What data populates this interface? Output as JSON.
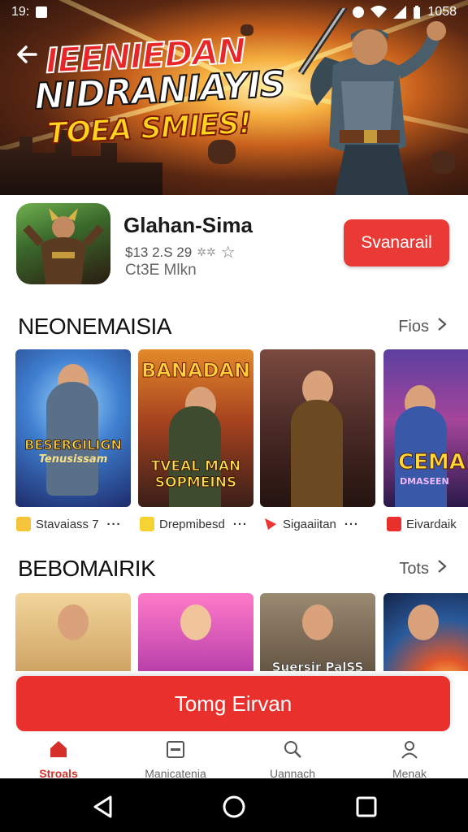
{
  "status_bar": {
    "time_left": "19:",
    "time_right": "1058"
  },
  "hero": {
    "title_line1": "IEENIEDAN",
    "title_line2": "NIDRANIAYIS",
    "title_line3": "TOEA SMIES!"
  },
  "app": {
    "name": "Glahan-Sima",
    "meta": "$13 2.S 29",
    "sub": "Ct3E Mlkn",
    "get_label": "Svanarail"
  },
  "section1": {
    "title": "NEONEMAISIA",
    "more_label": "Fiоs",
    "cards": [
      {
        "title": "BESERGILIGN",
        "subtitle": "Tenusissam"
      },
      {
        "title": "BANADAN",
        "subtitle": "TVEAL MAN SOPMEINS"
      },
      {
        "title": "",
        "subtitle": ""
      },
      {
        "title": "CEMAD",
        "subtitle": "DMASEEN"
      }
    ],
    "labels": [
      "Stavaiass 7",
      "Drepmibesd",
      "Sigaaiitan",
      "Eivardaik"
    ]
  },
  "section2": {
    "title": "BEBOMAIRIK",
    "more_label": "Tots",
    "cards": [
      {
        "title": ""
      },
      {
        "title": ""
      },
      {
        "title": "Suersir PalSS"
      },
      {
        "title": ""
      }
    ]
  },
  "cta_label": "Tomg Eirvan",
  "tabs": [
    {
      "label": "Stroals",
      "icon": "home-icon"
    },
    {
      "label": "Manicatenia",
      "icon": "calendar-icon"
    },
    {
      "label": "Uannach",
      "icon": "search-icon"
    },
    {
      "label": "Menak",
      "icon": "profile-icon"
    }
  ],
  "colors": {
    "accent": "#e9302c",
    "active_tab": "#d7302b"
  }
}
